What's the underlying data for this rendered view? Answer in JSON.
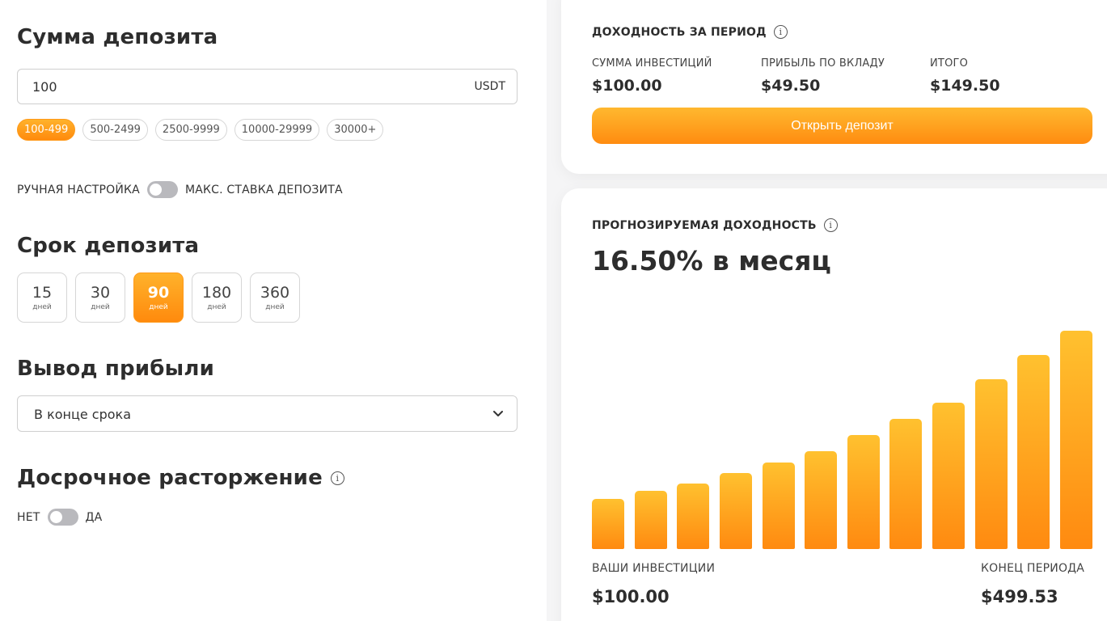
{
  "deposit": {
    "title": "Сумма депозита",
    "amount_value": "100",
    "currency": "USDT",
    "ranges": [
      "100-499",
      "500-2499",
      "2500-9999",
      "10000-29999",
      "30000+"
    ],
    "active_range": "100-499"
  },
  "rate_toggle": {
    "left_label": "РУЧНАЯ НАСТРОЙКА",
    "right_label": "МАКС. СТАВКА ДЕПОЗИТА"
  },
  "term": {
    "title": "Срок депозита",
    "options": [
      {
        "value": "15",
        "unit": "дней"
      },
      {
        "value": "30",
        "unit": "дней"
      },
      {
        "value": "90",
        "unit": "дней"
      },
      {
        "value": "180",
        "unit": "дней"
      },
      {
        "value": "360",
        "unit": "дней"
      }
    ],
    "active": "90"
  },
  "withdrawal": {
    "title": "Вывод прибыли",
    "selected": "В конце срока"
  },
  "early": {
    "title": "Досрочное расторжение",
    "no_label": "НЕТ",
    "yes_label": "ДА"
  },
  "period_card": {
    "title": "ДОХОДНОСТЬ ЗА ПЕРИОД",
    "invest_label": "СУММА ИНВЕСТИЦИЙ",
    "invest_value": "$100.00",
    "profit_label": "ПРИБЫЛЬ ПО ВКЛАДУ",
    "profit_value": "$49.50",
    "total_label": "ИТОГО",
    "total_value": "$149.50",
    "button_label": "Открыть депозит"
  },
  "forecast_card": {
    "title": "ПРОГНОЗИРУЕМАЯ ДОХОДНОСТЬ",
    "rate": "16.50% в месяц",
    "start_label": "ВАШИ ИНВЕСТИЦИИ",
    "start_value": "$100.00",
    "end_label": "КОНЕЦ ПЕРИОДА",
    "end_value": "$499.53"
  },
  "colors": {
    "accent_top": "#ffb82f",
    "accent_bottom": "#ff8c10"
  },
  "chart_data": {
    "type": "bar",
    "values": [
      62,
      72,
      81,
      94,
      107,
      121,
      141,
      161,
      181,
      210,
      240,
      270
    ],
    "ylim": [
      0,
      284
    ]
  }
}
